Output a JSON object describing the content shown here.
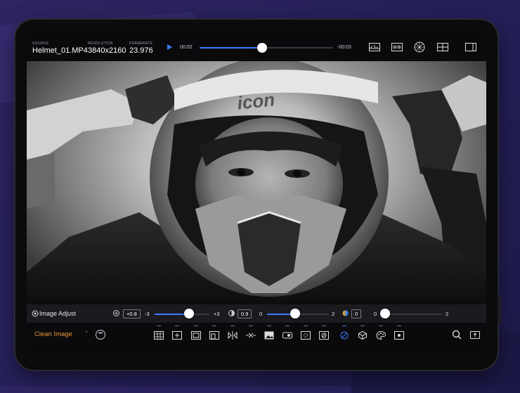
{
  "source": {
    "label": "SOURCE",
    "value": "Helmet_01.MP4"
  },
  "resolution": {
    "label": "RESOLUTION",
    "value": "3840x2160"
  },
  "framerate": {
    "label": "FRAMERATE",
    "value": "23.976"
  },
  "playback": {
    "elapsed": "00:02",
    "remaining": "-00:03",
    "progress": 0.47
  },
  "photo": {
    "helmet_brand": "icon"
  },
  "adjust": {
    "title": "Image Adjust",
    "exposure": {
      "value": "+0.8",
      "min": "-3",
      "max": "+3",
      "level": 0.63
    },
    "contrast": {
      "value": "0.9",
      "min": "0",
      "max": "2",
      "level": 0.45
    },
    "saturation": {
      "value": "0",
      "min": "0",
      "max": "2",
      "level": 0.0
    }
  },
  "preset": {
    "label": "Clean Image"
  },
  "more_label": "•••",
  "colors": {
    "accent": "#3b7cff",
    "preset_text": "#e8973a",
    "background": "#26205a"
  }
}
